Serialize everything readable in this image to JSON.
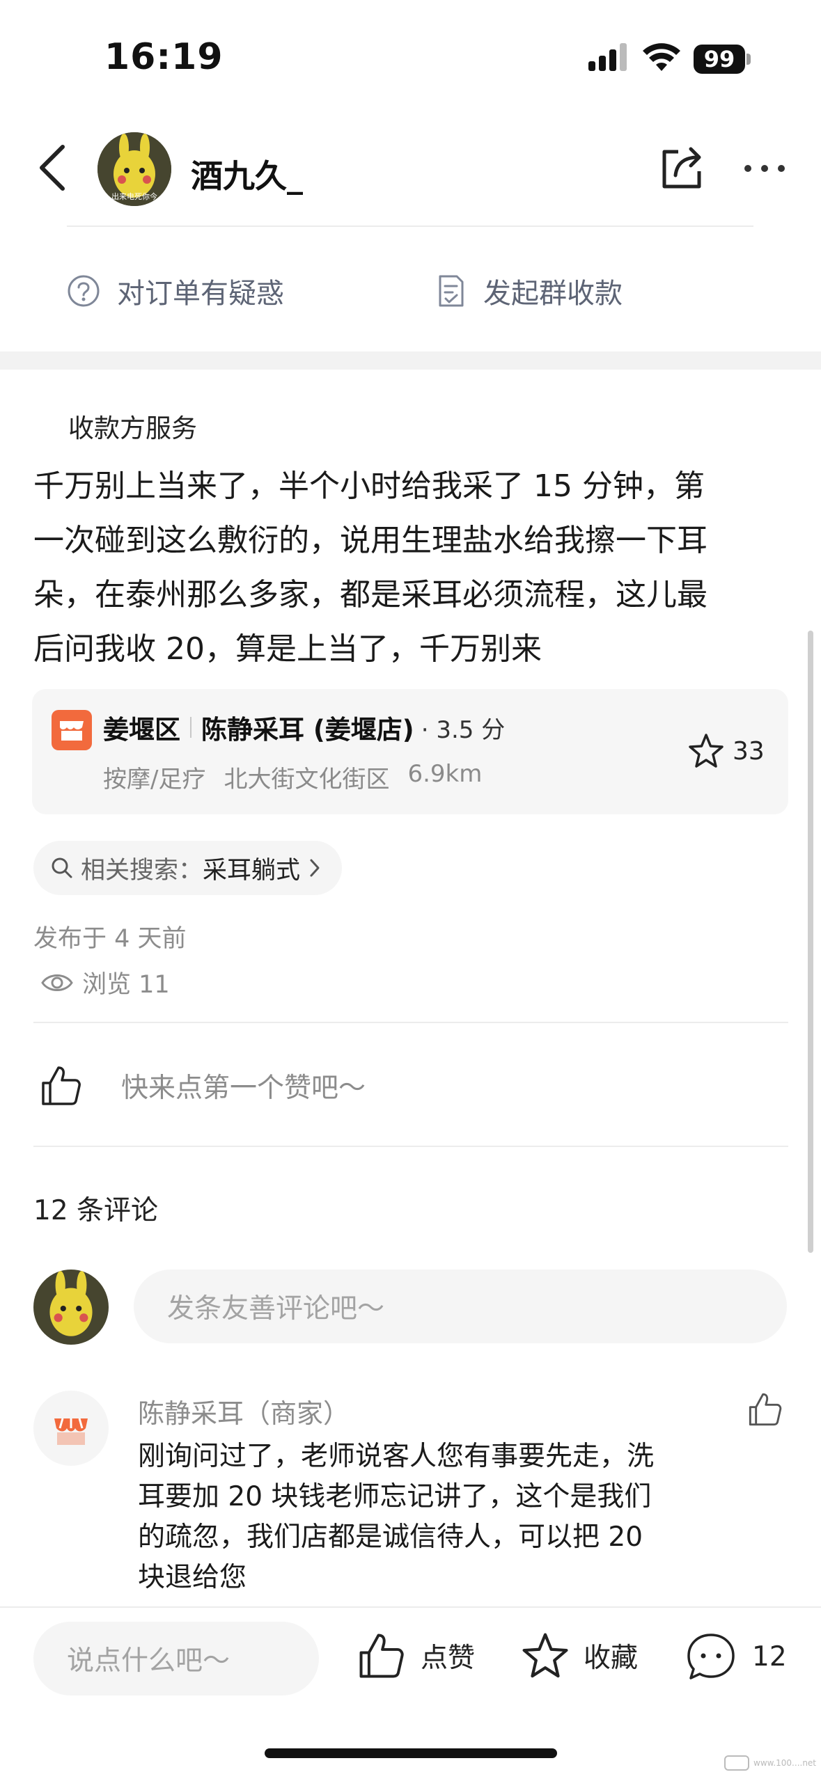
{
  "status_bar": {
    "time": "16:19",
    "battery": "99"
  },
  "header": {
    "username": "酒九久_",
    "avatar_caption": "出来电死你今"
  },
  "order_actions": {
    "query_label": "对订单有疑惑",
    "group_collect_label": "发起群收款"
  },
  "post": {
    "section_title": "收款方服务",
    "body": "千万别上当来了，半个小时给我采了15分钟，第一次碰到这么敷衍的，说用生理盐水给我擦一下耳朵，在泰州那么多家，都是采耳必须流程，这儿最后问我收20，算是上当了，千万别来",
    "body_lines": [
      "千万别上当来了，半个小时给我采了 15 分钟，第",
      "一次碰到这么敷衍的，说用生理盐水给我擦一下耳",
      "朵，在泰州那么多家，都是采耳必须流程，这儿最",
      "后问我收 20，算是上当了，千万别来"
    ],
    "published": "发布于 4 天前",
    "views": "浏览 11"
  },
  "shop_card": {
    "district": "姜堰区",
    "name": "陈静采耳 (姜堰店)",
    "rating": "· 3.5 分",
    "category": "按摩/足疗",
    "area": "北大街文化街区",
    "distance": "6.9km",
    "favorites": "33",
    "accent_color": "#f26a3d"
  },
  "related_search": {
    "prefix": "相关搜索：",
    "keyword": "采耳躺式"
  },
  "like_prompt": "快来点第一个赞吧～",
  "comments": {
    "count_label": "12 条评论",
    "input_placeholder": "发条友善评论吧～",
    "items": [
      {
        "author": "陈静采耳（商家）",
        "text_lines": [
          "刚询问过了，老师说客人您有事要先走，洗",
          "耳要加 20 块钱老师忘记讲了，这个是我们",
          "的疏忽，我们店都是诚信待人，可以把 20",
          "块退给您"
        ]
      }
    ]
  },
  "bottom_bar": {
    "input_placeholder": "说点什么吧～",
    "like_label": "点赞",
    "favorite_label": "收藏",
    "comment_count": "12"
  },
  "watermark": "www.100....net"
}
